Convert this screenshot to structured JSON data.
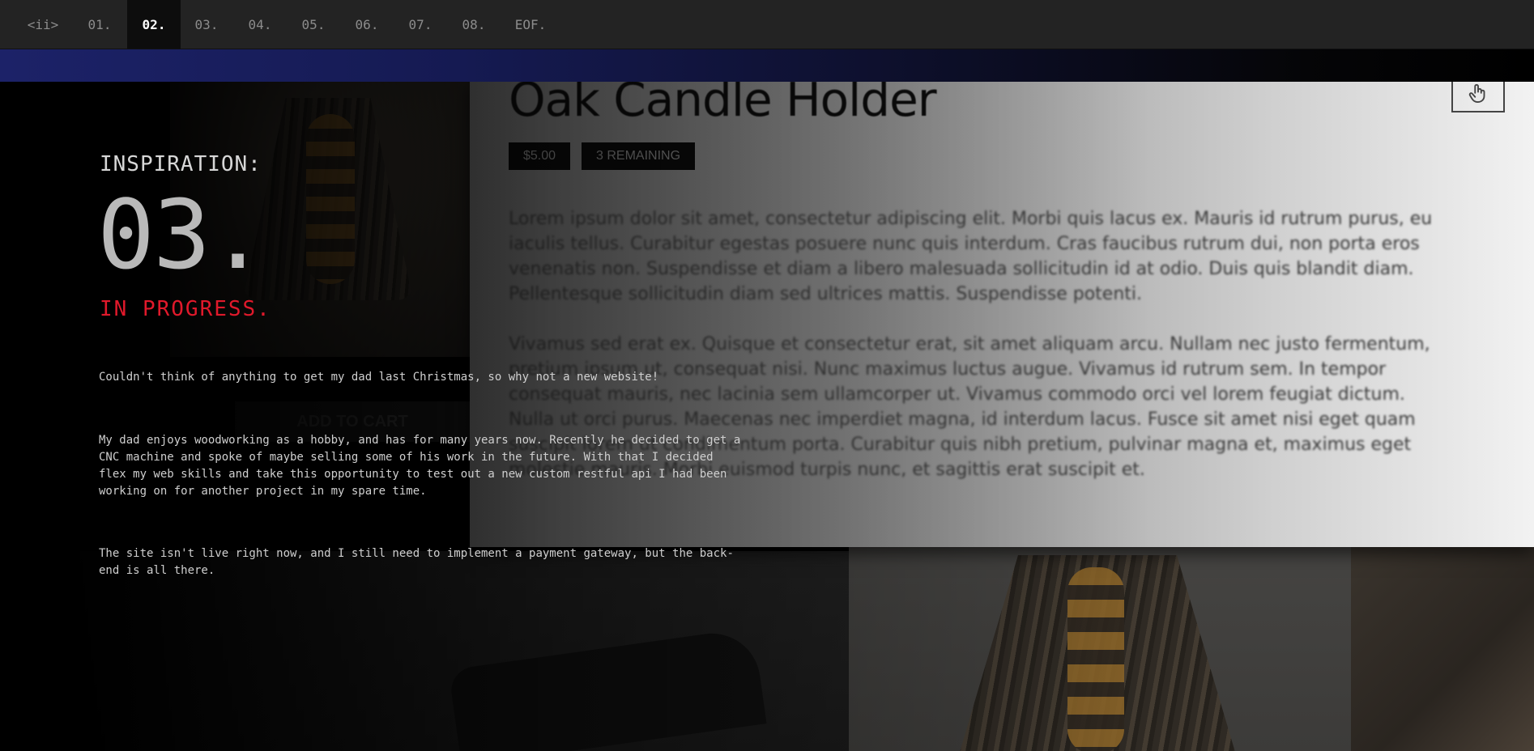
{
  "nav": {
    "items": [
      {
        "label": "<ii>",
        "active": false
      },
      {
        "label": "01.",
        "active": false
      },
      {
        "label": "02.",
        "active": true
      },
      {
        "label": "03.",
        "active": false
      },
      {
        "label": "04.",
        "active": false
      },
      {
        "label": "05.",
        "active": false
      },
      {
        "label": "06.",
        "active": false
      },
      {
        "label": "07.",
        "active": false
      },
      {
        "label": "08.",
        "active": false
      },
      {
        "label": "EOF.",
        "active": false
      }
    ]
  },
  "colors": {
    "accent_bar": "#1c2268",
    "status": "#e0192b",
    "nav_bg": "#232323",
    "nav_active_bg": "#0d0d0d"
  },
  "product": {
    "title": "Oak Candle Holder",
    "price": "$5.00",
    "stock": "3 REMAINING",
    "add_to_cart": "ADD TO CART",
    "cursor_icon": "hand-pointer-icon",
    "description": [
      "Lorem ipsum dolor sit amet, consectetur adipiscing elit. Morbi quis lacus ex. Mauris id rutrum purus, eu iaculis tellus. Curabitur egestas posuere nunc quis interdum. Cras faucibus rutrum dui, non porta eros venenatis non. Suspendisse et diam a libero malesuada sollicitudin id at odio. Duis quis blandit diam. Pellentesque sollicitudin diam sed ultrices mattis. Suspendisse potenti.",
      "Vivamus sed erat ex. Quisque et consectetur erat, sit amet aliquam arcu. Nullam nec justo fermentum, pretium ipsum ut, consequat nisi. Nunc maximus luctus augue. Vivamus id rutrum sem. In tempor consequat mauris, nec lacinia sem ullamcorper ut. Vivamus commodo orci vel lorem feugiat dictum. Nulla ut orci purus. Maecenas nec imperdiet magna, id interdum lacus. Fusce sit amet nisi eget quam suscipit lorem ut condimentum porta. Curabitur quis nibh pretium, pulvinar magna et, maximus eget molestie mauris. Morbi euismod turpis nunc, et sagittis erat suscipit et."
    ]
  },
  "project": {
    "label": "INSPIRATION:",
    "number": "03.",
    "status": "IN PROGRESS.",
    "paragraphs": [
      "Couldn't think of anything to get my dad last Christmas, so why not a new website!",
      "My dad enjoys woodworking as a hobby, and has for many years now. Recently he decided to get a CNC machine and spoke of maybe selling some of his work in the future. With that I decided flex my web skills and take this opportunity to test out a new custom restful api I had been working on for another project in my spare time.",
      "The site isn't live right now, and I still need to implement a payment gateway, but the back-end is all there."
    ]
  }
}
